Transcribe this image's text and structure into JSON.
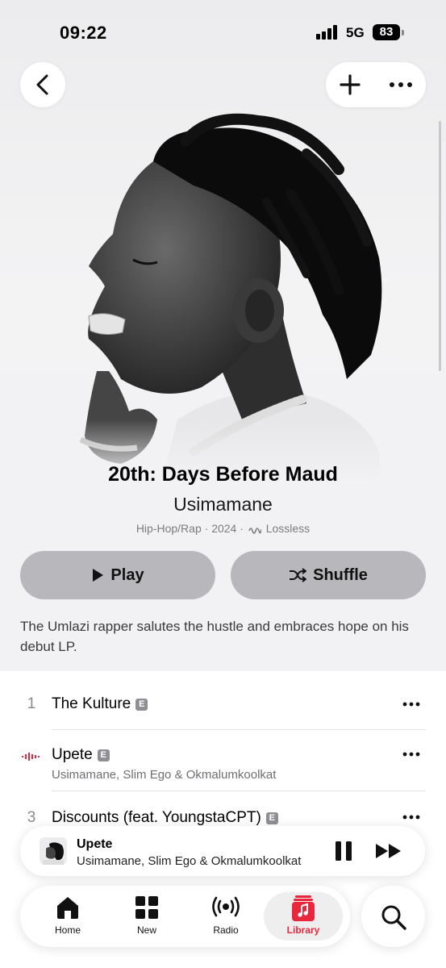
{
  "status_bar": {
    "time": "09:22",
    "network": "5G",
    "battery": "83"
  },
  "header": {
    "back_icon": "chevron-left-icon",
    "add_icon": "plus-icon",
    "more_icon": "ellipsis-icon"
  },
  "album": {
    "title": "20th: Days Before Maud",
    "artist": "Usimamane",
    "genre": "Hip-Hop/Rap",
    "year": "2024",
    "quality": "Lossless",
    "description": "The Umlazi rapper salutes the hustle and embraces hope on his debut LP."
  },
  "actions": {
    "play_label": "Play",
    "shuffle_label": "Shuffle"
  },
  "tracks": [
    {
      "number": "1",
      "title": "The Kulture",
      "explicit": "E",
      "artists": ""
    },
    {
      "number": "",
      "title": "Upete",
      "explicit": "E",
      "artists": "Usimamane, Slim Ego & Okmalumkoolkat",
      "playing": true
    },
    {
      "number": "3",
      "title": "Discounts (feat. YoungstaCPT)",
      "explicit": "E",
      "artists": ""
    }
  ],
  "mini_player": {
    "title": "Upete",
    "artists": "Usimamane, Slim Ego & Okmalumkoolkat"
  },
  "tabs": [
    {
      "label": "Home",
      "icon": "home-icon"
    },
    {
      "label": "New",
      "icon": "grid-icon"
    },
    {
      "label": "Radio",
      "icon": "radio-icon"
    },
    {
      "label": "Library",
      "icon": "library-icon",
      "active": true
    }
  ],
  "accent_color": "#e9263c"
}
